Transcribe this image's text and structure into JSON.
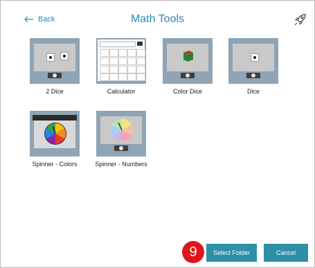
{
  "header": {
    "back_label": "Back",
    "title": "Math Tools",
    "rocket_icon": "rocket-icon"
  },
  "tools": [
    {
      "label": "2 Dice",
      "icon": "dice-pair-icon"
    },
    {
      "label": "Calculator",
      "icon": "calculator-icon"
    },
    {
      "label": "Color Dice",
      "icon": "color-dice-icon"
    },
    {
      "label": "Dice",
      "icon": "dice-icon"
    },
    {
      "label": "Spinner - Colors",
      "icon": "color-spinner-icon"
    },
    {
      "label": "Spinner - Numbers",
      "icon": "number-spinner-icon"
    }
  ],
  "footer": {
    "step_badge": "9",
    "select_folder_label": "Select Folder",
    "cancel_label": "Cancel"
  },
  "colors": {
    "accent": "#2b88b8",
    "button": "#2e8fa6",
    "badge": "#e1141b",
    "tile_frame": "#8fa4b4"
  }
}
